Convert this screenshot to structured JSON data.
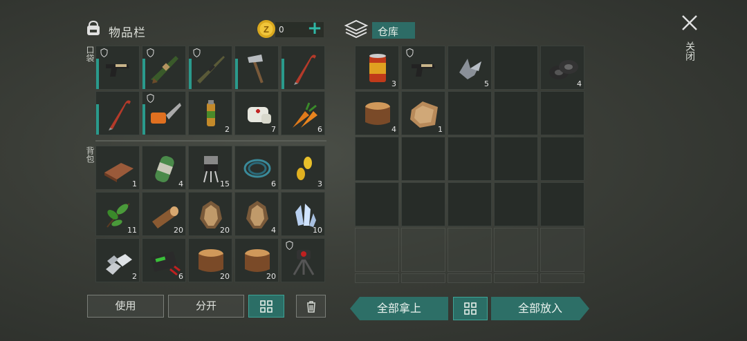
{
  "inventory": {
    "title": "物品栏",
    "coins": "0",
    "pocket_label": "口袋",
    "backpack_label": "背包",
    "pocket": [
      {
        "name": "pistol",
        "count": "",
        "shield": true,
        "bar": true
      },
      {
        "name": "shotgun",
        "count": "",
        "shield": true,
        "bar": true
      },
      {
        "name": "rifle",
        "count": "",
        "shield": true,
        "bar": true
      },
      {
        "name": "hatchet",
        "count": "",
        "shield": false,
        "bar": true
      },
      {
        "name": "crowbar",
        "count": "",
        "shield": false,
        "bar": true
      },
      {
        "name": "crowbar",
        "count": "",
        "shield": false,
        "bar": true
      },
      {
        "name": "chainsaw",
        "count": "",
        "shield": true,
        "bar": true
      },
      {
        "name": "vial",
        "count": "2",
        "shield": false,
        "bar": false
      },
      {
        "name": "bandage",
        "count": "7",
        "shield": false,
        "bar": false
      },
      {
        "name": "carrot",
        "count": "6",
        "shield": false,
        "bar": false
      }
    ],
    "backpack": [
      {
        "name": "plank",
        "count": "1",
        "shield": false
      },
      {
        "name": "battery-cell",
        "count": "4",
        "shield": false
      },
      {
        "name": "transistor",
        "count": "15",
        "shield": false
      },
      {
        "name": "wire",
        "count": "6",
        "shield": false
      },
      {
        "name": "seeds",
        "count": "3",
        "shield": false
      },
      {
        "name": "leaf",
        "count": "11",
        "shield": false
      },
      {
        "name": "log",
        "count": "20",
        "shield": false
      },
      {
        "name": "hide",
        "count": "20",
        "shield": false
      },
      {
        "name": "hide",
        "count": "4",
        "shield": false
      },
      {
        "name": "crystal",
        "count": "10",
        "shield": false
      },
      {
        "name": "metal",
        "count": "2",
        "shield": false
      },
      {
        "name": "car-battery",
        "count": "6",
        "shield": false
      },
      {
        "name": "stump",
        "count": "20",
        "shield": false
      },
      {
        "name": "stump",
        "count": "20",
        "shield": false
      },
      {
        "name": "turret",
        "count": "",
        "shield": true
      }
    ],
    "buttons": {
      "use": "使用",
      "split": "分开"
    }
  },
  "storage": {
    "tab": "仓库",
    "items": [
      {
        "name": "food-can",
        "count": "3",
        "shield": false
      },
      {
        "name": "pistol",
        "count": "",
        "shield": true
      },
      {
        "name": "scrap",
        "count": "5",
        "shield": false
      },
      {
        "name": "",
        "count": "",
        "shield": false
      },
      {
        "name": "tires",
        "count": "4",
        "shield": false
      },
      {
        "name": "stump",
        "count": "4",
        "shield": false
      },
      {
        "name": "leather",
        "count": "1",
        "shield": false
      }
    ],
    "buttons": {
      "take_all": "全部拿上",
      "put_all": "全部放入"
    }
  },
  "close_label": "关闭",
  "colors": {
    "accent": "#2fb8a6",
    "button_teal": "#2b6e66"
  }
}
